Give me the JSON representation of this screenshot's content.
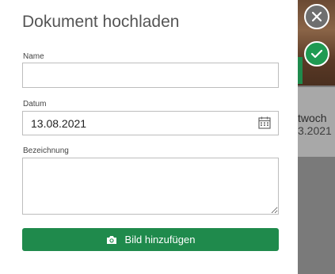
{
  "dialog": {
    "title": "Dokument hochladen",
    "name_label": "Name",
    "name_value": "",
    "date_label": "Datum",
    "date_value": "13.08.2021",
    "description_label": "Bezeichnung",
    "description_value": "",
    "add_image_label": "Bild hinzufügen"
  },
  "background": {
    "weekday_partial": "twoch",
    "date_partial": "3.2021"
  },
  "icons": {
    "close": "close-icon",
    "confirm": "check-icon",
    "calendar": "calendar-icon",
    "camera": "camera-icon"
  },
  "colors": {
    "accent_green": "#1f8a4c",
    "confirm_green": "#1f9a52",
    "overlay_gray": "#7a7a7a"
  }
}
